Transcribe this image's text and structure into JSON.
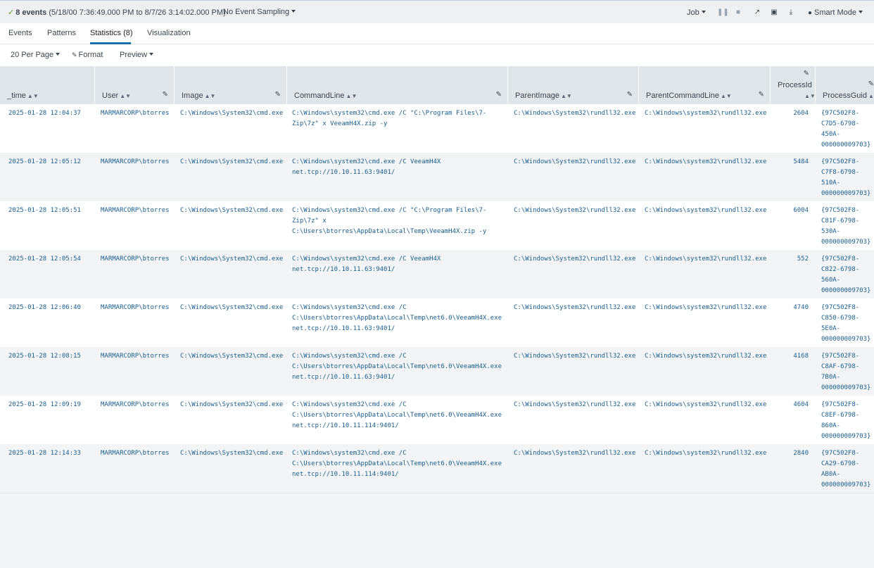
{
  "topbar": {
    "check_icon": "check-icon",
    "event_count": "8 events",
    "range": "(5/18/00 7:36:49.000 PM to 8/7/26 3:14:02.000 PM)",
    "sampling": "No Event Sampling",
    "job": "Job",
    "smart_mode": "Smart Mode",
    "icons": [
      "pause-icon",
      "stop-icon",
      "share-icon",
      "print-icon",
      "export-icon",
      "bulb-icon"
    ]
  },
  "tabs": [
    {
      "label": "Events"
    },
    {
      "label": "Patterns"
    },
    {
      "label": "Statistics (8)",
      "active": true
    },
    {
      "label": "Visualization"
    }
  ],
  "toolbar": {
    "per_page": "20 Per Page",
    "format": "Format",
    "preview": "Preview"
  },
  "columns": [
    {
      "label": "_time"
    },
    {
      "label": "User"
    },
    {
      "label": "Image"
    },
    {
      "label": "CommandLine"
    },
    {
      "label": "ParentImage"
    },
    {
      "label": "ParentCommandLine"
    },
    {
      "label": "ProcessId"
    },
    {
      "label": "ProcessGuid"
    }
  ],
  "rows": [
    {
      "time": "2025-01-28 12:04:37",
      "user": "MARMARCORP\\btorres",
      "image": "C:\\Windows\\System32\\cmd.exe",
      "cmd": "C:\\Windows\\system32\\cmd.exe /C \"C:\\Program Files\\7-\nZip\\7z\" x VeeamH4X.zip -y",
      "pimage": "C:\\Windows\\System32\\rundll32.exe",
      "pcmd": "C:\\Windows\\system32\\rundll32.exe",
      "pid": "2604",
      "guid": "{97C502F8-\nC7D5-6798-\n450A-\n000000009703}"
    },
    {
      "time": "2025-01-28 12:05:12",
      "user": "MARMARCORP\\btorres",
      "image": "C:\\Windows\\System32\\cmd.exe",
      "cmd": "C:\\Windows\\system32\\cmd.exe /C VeeamH4X\nnet.tcp://10.10.11.63:9401/",
      "pimage": "C:\\Windows\\System32\\rundll32.exe",
      "pcmd": "C:\\Windows\\system32\\rundll32.exe",
      "pid": "5484",
      "guid": "{97C502F8-\nC7F8-6798-\n510A-\n000000009703}"
    },
    {
      "time": "2025-01-28 12:05:51",
      "user": "MARMARCORP\\btorres",
      "image": "C:\\Windows\\System32\\cmd.exe",
      "cmd": "C:\\Windows\\system32\\cmd.exe /C \"C:\\Program Files\\7-\nZip\\7z\" x\nC:\\Users\\btorres\\AppData\\Local\\Temp\\VeeamH4X.zip -y",
      "pimage": "C:\\Windows\\System32\\rundll32.exe",
      "pcmd": "C:\\Windows\\system32\\rundll32.exe",
      "pid": "6004",
      "guid": "{97C502F8-\nC81F-6798-\n530A-\n000000009703}"
    },
    {
      "time": "2025-01-28 12:05:54",
      "user": "MARMARCORP\\btorres",
      "image": "C:\\Windows\\System32\\cmd.exe",
      "cmd": "C:\\Windows\\system32\\cmd.exe /C VeeamH4X\nnet.tcp://10.10.11.63:9401/",
      "pimage": "C:\\Windows\\System32\\rundll32.exe",
      "pcmd": "C:\\Windows\\system32\\rundll32.exe",
      "pid": "552",
      "guid": "{97C502F8-\nC822-6798-\n560A-\n000000009703}"
    },
    {
      "time": "2025-01-28 12:06:40",
      "user": "MARMARCORP\\btorres",
      "image": "C:\\Windows\\System32\\cmd.exe",
      "cmd": "C:\\Windows\\system32\\cmd.exe /C\nC:\\Users\\btorres\\AppData\\Local\\Temp\\net6.0\\VeeamH4X.exe\nnet.tcp://10.10.11.63:9401/",
      "pimage": "C:\\Windows\\System32\\rundll32.exe",
      "pcmd": "C:\\Windows\\system32\\rundll32.exe",
      "pid": "4740",
      "guid": "{97C502F8-\nC850-6798-\n5E0A-\n000000009703}"
    },
    {
      "time": "2025-01-28 12:08:15",
      "user": "MARMARCORP\\btorres",
      "image": "C:\\Windows\\System32\\cmd.exe",
      "cmd": "C:\\Windows\\system32\\cmd.exe /C\nC:\\Users\\btorres\\AppData\\Local\\Temp\\net6.0\\VeeamH4X.exe\nnet.tcp://10.10.11.63:9401/",
      "pimage": "C:\\Windows\\System32\\rundll32.exe",
      "pcmd": "C:\\Windows\\system32\\rundll32.exe",
      "pid": "4168",
      "guid": "{97C502F8-\nC8AF-6798-\n7B0A-\n000000009703}"
    },
    {
      "time": "2025-01-28 12:09:19",
      "user": "MARMARCORP\\btorres",
      "image": "C:\\Windows\\System32\\cmd.exe",
      "cmd": "C:\\Windows\\system32\\cmd.exe /C\nC:\\Users\\btorres\\AppData\\Local\\Temp\\net6.0\\VeeamH4X.exe\nnet.tcp://10.10.11.114:9401/",
      "pimage": "C:\\Windows\\System32\\rundll32.exe",
      "pcmd": "C:\\Windows\\system32\\rundll32.exe",
      "pid": "4604",
      "guid": "{97C502F8-\nC8EF-6798-\n860A-\n000000009703}"
    },
    {
      "time": "2025-01-28 12:14:33",
      "user": "MARMARCORP\\btorres",
      "image": "C:\\Windows\\System32\\cmd.exe",
      "cmd": "C:\\Windows\\system32\\cmd.exe /C\nC:\\Users\\btorres\\AppData\\Local\\Temp\\net6.0\\VeeamH4X.exe\nnet.tcp://10.10.11.114:9401/",
      "pimage": "C:\\Windows\\System32\\rundll32.exe",
      "pcmd": "C:\\Windows\\system32\\rundll32.exe",
      "pid": "2840",
      "guid": "{97C502F8-\nCA29-6798-\nAB0A-\n000000009703}"
    }
  ],
  "colors": {
    "link": "#1a5d8f",
    "tab_accent": "#1a6fa8",
    "success": "#5a9b2a",
    "header_bg": "#e1e6eb"
  }
}
